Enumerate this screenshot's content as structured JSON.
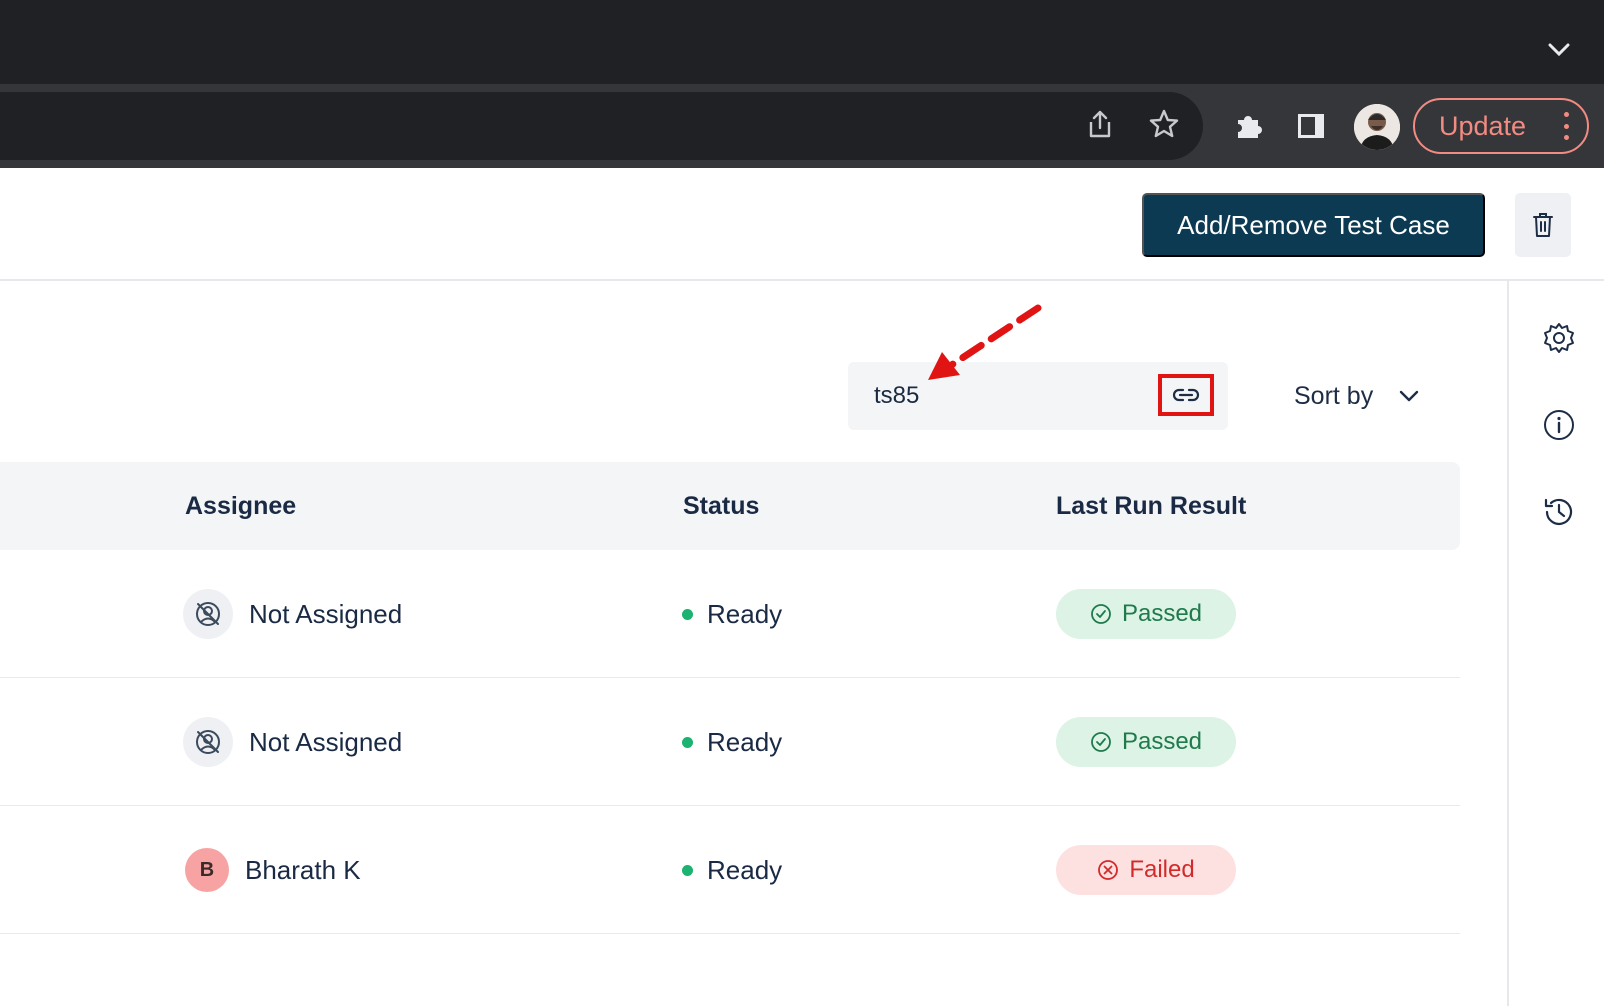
{
  "browser": {
    "update_label": "Update"
  },
  "header": {
    "add_remove_label": "Add/Remove Test Case"
  },
  "search": {
    "value": "ts85"
  },
  "sort": {
    "label": "Sort by"
  },
  "table": {
    "columns": [
      "Assignee",
      "Status",
      "Last Run Result"
    ],
    "rows": [
      {
        "assignee": "Not Assigned",
        "assignee_type": "unassigned",
        "status": "Ready",
        "result": "Passed",
        "result_type": "passed"
      },
      {
        "assignee": "Not Assigned",
        "assignee_type": "unassigned",
        "status": "Ready",
        "result": "Passed",
        "result_type": "passed"
      },
      {
        "assignee": "Bharath K",
        "assignee_type": "user",
        "initial": "B",
        "status": "Ready",
        "result": "Failed",
        "result_type": "failed"
      }
    ]
  },
  "colors": {
    "primary": "#0c3a52",
    "annotation": "#e11414",
    "status_ready": "#1bb36f",
    "passed_bg": "#dcf3e6",
    "failed_bg": "#fde1e1"
  },
  "icons": {
    "tabstrip": [
      "chevron-down-icon"
    ],
    "toolbar": [
      "share-icon",
      "star-icon",
      "extensions-icon",
      "side-panel-icon",
      "profile-avatar",
      "more-vert-icon"
    ],
    "header": [
      "trash-icon"
    ],
    "search": [
      "link-icon"
    ],
    "rail": [
      "settings-icon",
      "info-icon",
      "history-icon"
    ]
  }
}
